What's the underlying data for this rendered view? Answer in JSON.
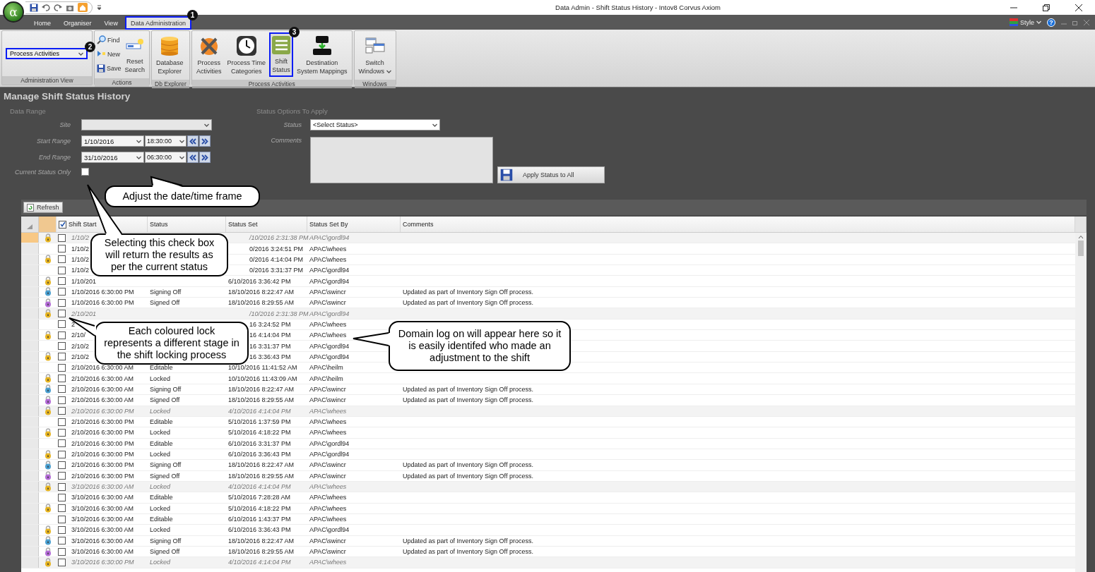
{
  "window": {
    "title": "Data Admin - Shift Status History - Intov8 Corvus Axiom"
  },
  "app_menu": {
    "label": "α"
  },
  "ribbon_tabs": [
    {
      "label": "Home",
      "selected": false,
      "highlighted": false
    },
    {
      "label": "Organiser",
      "selected": false,
      "highlighted": false
    },
    {
      "label": "View",
      "selected": false,
      "highlighted": false
    },
    {
      "label": "Data Administration",
      "selected": true,
      "highlighted": true,
      "badge": "1"
    }
  ],
  "ribbon_right": {
    "style_label": "Style",
    "help": "?"
  },
  "ribbon_groups": [
    {
      "title": "Administration View",
      "dropdown": {
        "value": "Process Activities",
        "highlighted": true,
        "badge": "2"
      }
    },
    {
      "title": "Actions",
      "small_buttons": [
        {
          "label": "Find"
        },
        {
          "label": "New"
        },
        {
          "label": "Save"
        }
      ],
      "large_buttons": [
        {
          "lines": [
            "Reset",
            "Search"
          ],
          "highlighted": false
        }
      ]
    },
    {
      "title": "Db Explorer",
      "large_buttons": [
        {
          "lines": [
            "Database",
            "Explorer"
          ],
          "highlighted": false
        }
      ]
    },
    {
      "title": "Process Activities",
      "large_buttons": [
        {
          "lines": [
            "Process",
            "Activities"
          ],
          "highlighted": false
        },
        {
          "lines": [
            "Process Time",
            "Categories"
          ],
          "highlighted": false
        },
        {
          "lines": [
            "Shift",
            "Status"
          ],
          "highlighted": true,
          "badge": "3"
        },
        {
          "lines": [
            "Destination",
            "System Mappings"
          ],
          "highlighted": false
        }
      ]
    },
    {
      "title": "Windows",
      "large_buttons": [
        {
          "lines": [
            "Switch",
            "Windows"
          ],
          "highlighted": false,
          "menu": true
        }
      ]
    }
  ],
  "page_title": "Manage Shift Status History",
  "data_range": {
    "title": "Data Range",
    "site": {
      "label": "Site"
    },
    "start": {
      "label": "Start Range",
      "date": "1/10/2016",
      "time": "18:30:00"
    },
    "end": {
      "label": "End Range",
      "date": "31/10/2016",
      "time": "06:30:00"
    },
    "current_status_only": {
      "label": "Current Status Only",
      "checked": false
    }
  },
  "status_options": {
    "title": "Status Options To Apply",
    "status": {
      "label": "Status",
      "value": "<Select Status>"
    },
    "comments": {
      "label": "Comments"
    },
    "apply_button": "Apply Status to All"
  },
  "refresh_button": "Refresh",
  "table": {
    "header_checked": true,
    "columns": [
      "Shift Start",
      "Status",
      "Status Set",
      "Status Set By",
      "Comments"
    ],
    "rows": [
      {
        "kind": "group",
        "selected": true,
        "checked": false,
        "color": "#e6b422",
        "covered": true,
        "shift": "1/10/2",
        "set": "/10/2016 2:31:38 PM",
        "by": "APAC\\gordl94"
      },
      {
        "kind": "entry",
        "selected": false,
        "checked": false,
        "covered": true,
        "shift": "1/10/2",
        "set": "0/2016 3:24:51 PM",
        "by": "APAC\\whees"
      },
      {
        "kind": "entry",
        "selected": false,
        "checked": false,
        "color": "#e6b422",
        "covered": true,
        "shift": "1/10/2",
        "set": "0/2016 4:14:04 PM",
        "by": "APAC\\whees"
      },
      {
        "kind": "entry",
        "selected": false,
        "checked": false,
        "covered": true,
        "shift": "1/10/2",
        "set": "0/2016 3:31:37 PM",
        "by": "APAC\\gordl94"
      },
      {
        "kind": "entry",
        "selected": false,
        "checked": false,
        "color": "#e6b422",
        "covered": false,
        "shift": "1/10/201",
        "set": "6/10/2016 3:36:42 PM",
        "by": "APAC\\gordl94"
      },
      {
        "kind": "entry",
        "selected": false,
        "checked": false,
        "color": "#4a9fd0",
        "covered": false,
        "shift": "1/10/2016 6:30:00 PM",
        "status": "Signing Off",
        "set": "18/10/2016 8:22:47 AM",
        "by": "APAC\\swincr",
        "comments": "Updated as part of Inventory Sign Off process."
      },
      {
        "kind": "entry",
        "selected": false,
        "checked": false,
        "color": "#b36bd6",
        "covered": false,
        "shift": "1/10/2016 6:30:00 PM",
        "status": "Signed Off",
        "set": "18/10/2016 8:29:55 AM",
        "by": "APAC\\swincr",
        "comments": "Updated as part of Inventory Sign Off process."
      },
      {
        "kind": "group",
        "selected": false,
        "checked": false,
        "color": "#e6b422",
        "covered": true,
        "shift": "2/10/201",
        "set": "/10/2016 2:31:38 PM",
        "by": "APAC\\gordl94"
      },
      {
        "kind": "entry",
        "selected": false,
        "checked": false,
        "covered": true,
        "shift": "2",
        "set": "16 3:24:52 PM",
        "by": "APAC\\whees"
      },
      {
        "kind": "entry",
        "selected": false,
        "checked": false,
        "color": "#e6b422",
        "covered": true,
        "shift": "2/10/",
        "set": "16 4:14:04 PM",
        "by": "APAC\\whees"
      },
      {
        "kind": "entry",
        "selected": false,
        "checked": false,
        "covered": true,
        "shift": "2/10/2",
        "set": "16 3:31:37 PM",
        "by": "APAC\\gordl94"
      },
      {
        "kind": "entry",
        "selected": false,
        "checked": false,
        "color": "#e6b422",
        "covered": true,
        "shift": "2/10/2",
        "set": "16 3:36:43 PM",
        "by": "APAC\\gordl94"
      },
      {
        "kind": "entry",
        "selected": false,
        "checked": false,
        "covered": false,
        "shift": "2/10/2016 6:30:00 AM",
        "status": "Editable",
        "set": "10/10/2016 11:41:52 AM",
        "by": "APAC\\heilm"
      },
      {
        "kind": "entry",
        "selected": false,
        "checked": false,
        "color": "#e6b422",
        "covered": false,
        "shift": "2/10/2016 6:30:00 AM",
        "status": "Locked",
        "set": "10/10/2016 11:43:09 AM",
        "by": "APAC\\heilm"
      },
      {
        "kind": "entry",
        "selected": false,
        "checked": false,
        "color": "#4a9fd0",
        "covered": false,
        "shift": "2/10/2016 6:30:00 AM",
        "status": "Signing Off",
        "set": "18/10/2016 8:22:47 AM",
        "by": "APAC\\swincr",
        "comments": "Updated as part of Inventory Sign Off process."
      },
      {
        "kind": "entry",
        "selected": false,
        "checked": false,
        "color": "#b36bd6",
        "covered": false,
        "shift": "2/10/2016 6:30:00 AM",
        "status": "Signed Off",
        "set": "18/10/2016 8:29:55 AM",
        "by": "APAC\\swincr",
        "comments": "Updated as part of Inventory Sign Off process."
      },
      {
        "kind": "group",
        "selected": false,
        "checked": false,
        "color": "#e6b422",
        "covered": false,
        "shift": "2/10/2016 6:30:00 PM",
        "status": "Locked",
        "set": "4/10/2016 4:14:04 PM",
        "by": "APAC\\whees"
      },
      {
        "kind": "entry",
        "selected": false,
        "checked": false,
        "covered": false,
        "shift": "2/10/2016 6:30:00 PM",
        "status": "Editable",
        "set": "5/10/2016 1:37:59 PM",
        "by": "APAC\\whees"
      },
      {
        "kind": "entry",
        "selected": false,
        "checked": false,
        "color": "#e6b422",
        "covered": false,
        "shift": "2/10/2016 6:30:00 PM",
        "status": "Locked",
        "set": "5/10/2016 4:18:22 PM",
        "by": "APAC\\whees"
      },
      {
        "kind": "entry",
        "selected": false,
        "checked": false,
        "covered": false,
        "shift": "2/10/2016 6:30:00 PM",
        "status": "Editable",
        "set": "6/10/2016 3:31:37 PM",
        "by": "APAC\\gordl94"
      },
      {
        "kind": "entry",
        "selected": false,
        "checked": false,
        "color": "#e6b422",
        "covered": false,
        "shift": "2/10/2016 6:30:00 PM",
        "status": "Locked",
        "set": "6/10/2016 3:36:43 PM",
        "by": "APAC\\gordl94"
      },
      {
        "kind": "entry",
        "selected": false,
        "checked": false,
        "color": "#4a9fd0",
        "covered": false,
        "shift": "2/10/2016 6:30:00 PM",
        "status": "Signing Off",
        "set": "18/10/2016 8:22:47 AM",
        "by": "APAC\\swincr",
        "comments": "Updated as part of Inventory Sign Off process."
      },
      {
        "kind": "entry",
        "selected": false,
        "checked": false,
        "color": "#b36bd6",
        "covered": false,
        "shift": "2/10/2016 6:30:00 PM",
        "status": "Signed Off",
        "set": "18/10/2016 8:29:55 AM",
        "by": "APAC\\swincr",
        "comments": "Updated as part of Inventory Sign Off process."
      },
      {
        "kind": "group",
        "selected": false,
        "checked": false,
        "color": "#e6b422",
        "covered": false,
        "shift": "3/10/2016 6:30:00 AM",
        "status": "Locked",
        "set": "4/10/2016 4:14:04 PM",
        "by": "APAC\\whees"
      },
      {
        "kind": "entry",
        "selected": false,
        "checked": false,
        "covered": false,
        "shift": "3/10/2016 6:30:00 AM",
        "status": "Editable",
        "set": "5/10/2016 7:28:28 AM",
        "by": "APAC\\whees"
      },
      {
        "kind": "entry",
        "selected": false,
        "checked": false,
        "color": "#e6b422",
        "covered": false,
        "shift": "3/10/2016 6:30:00 AM",
        "status": "Locked",
        "set": "5/10/2016 4:18:22 PM",
        "by": "APAC\\whees"
      },
      {
        "kind": "entry",
        "selected": false,
        "checked": false,
        "covered": false,
        "shift": "3/10/2016 6:30:00 AM",
        "status": "Editable",
        "set": "6/10/2016 1:43:37 PM",
        "by": "APAC\\whees"
      },
      {
        "kind": "entry",
        "selected": false,
        "checked": false,
        "color": "#e6b422",
        "covered": false,
        "shift": "3/10/2016 6:30:00 AM",
        "status": "Locked",
        "set": "6/10/2016 3:36:43 PM",
        "by": "APAC\\gordl94"
      },
      {
        "kind": "entry",
        "selected": false,
        "checked": false,
        "color": "#4a9fd0",
        "covered": false,
        "shift": "3/10/2016 6:30:00 AM",
        "status": "Signing Off",
        "set": "18/10/2016 8:22:47 AM",
        "by": "APAC\\swincr",
        "comments": "Updated as part of Inventory Sign Off process."
      },
      {
        "kind": "entry",
        "selected": false,
        "checked": false,
        "color": "#b36bd6",
        "covered": false,
        "shift": "3/10/2016 6:30:00 AM",
        "status": "Signed Off",
        "set": "18/10/2016 8:29:55 AM",
        "by": "APAC\\swincr",
        "comments": "Updated as part of Inventory Sign Off process."
      },
      {
        "kind": "group",
        "selected": false,
        "checked": false,
        "color": "#e6b422",
        "covered": false,
        "shift": "3/10/2016 6:30:00 PM",
        "status": "Locked",
        "set": "4/10/2016 4:14:04 PM",
        "by": "APAC\\whees"
      }
    ]
  },
  "callouts": [
    "Adjust the date/time frame",
    "Selecting this check box will return the results as per the current status",
    "Each coloured lock represents a different stage in the shift locking process",
    "Domain log on will appear here so it is easily identifed who made an adjustment to the shift"
  ]
}
